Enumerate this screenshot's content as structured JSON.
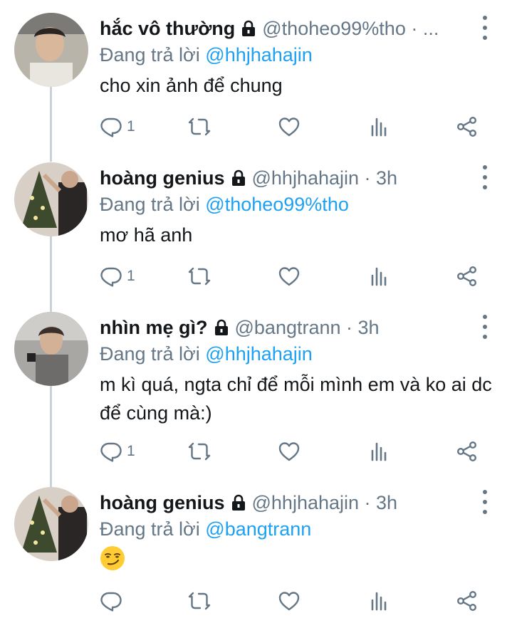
{
  "colors": {
    "link": "#1da1f2",
    "secondary": "#657786",
    "text": "#14171a",
    "thread_line": "#c9d1d9"
  },
  "tweets": [
    {
      "name": "hắc vô thường",
      "handle": "@thoheo99%tho · ...",
      "reply_prefix": "Đang trả lời",
      "reply_to": "@hhjhahajin",
      "text": "cho xin ảnh để chung",
      "reply_count": "1",
      "icons": [
        "reply-icon",
        "retweet-icon",
        "like-icon",
        "analytics-icon",
        "share-icon"
      ]
    },
    {
      "name": "hoàng genius",
      "handle": "@hhjhahajin · 3h",
      "reply_prefix": "Đang trả lời",
      "reply_to": "@thoheo99%tho",
      "text": "mơ hã anh",
      "reply_count": "1",
      "icons": [
        "reply-icon",
        "retweet-icon",
        "like-icon",
        "analytics-icon",
        "share-icon"
      ]
    },
    {
      "name": "nhìn mẹ gì?",
      "handle": "@bangtrann · 3h",
      "reply_prefix": "Đang trả lời",
      "reply_to": "@hhjhahajin",
      "text": "m kì quá, ngta chỉ để mỗi mình em và ko ai dc để cùng mà:)",
      "reply_count": "1",
      "icons": [
        "reply-icon",
        "retweet-icon",
        "like-icon",
        "analytics-icon",
        "share-icon"
      ]
    },
    {
      "name": "hoàng genius",
      "handle": "@hhjhahajin · 3h",
      "reply_prefix": "Đang trả lời",
      "reply_to": "@bangtrann",
      "text": "",
      "reply_count": "",
      "emoji": "smirking-face-emoji",
      "icons": [
        "reply-icon",
        "retweet-icon",
        "like-icon",
        "analytics-icon",
        "share-icon"
      ]
    }
  ]
}
